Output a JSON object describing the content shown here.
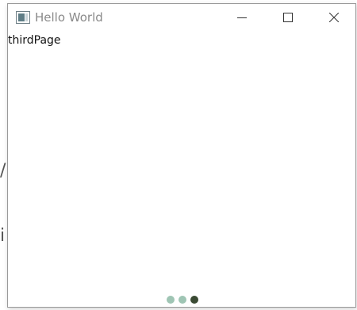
{
  "window": {
    "title": "Hello World"
  },
  "icons": {
    "app": "window-app-icon",
    "minimize": "minimize-icon",
    "maximize": "maximize-icon",
    "close": "close-icon"
  },
  "content": {
    "page_label": "thirdPage"
  },
  "pager": {
    "total_pages": 3,
    "current_page": 3,
    "colors": {
      "inactive": "#9fc5b4",
      "active": "#3a4a33"
    }
  },
  "background_window": {
    "glyph_1": "/",
    "glyph_2": "i"
  }
}
